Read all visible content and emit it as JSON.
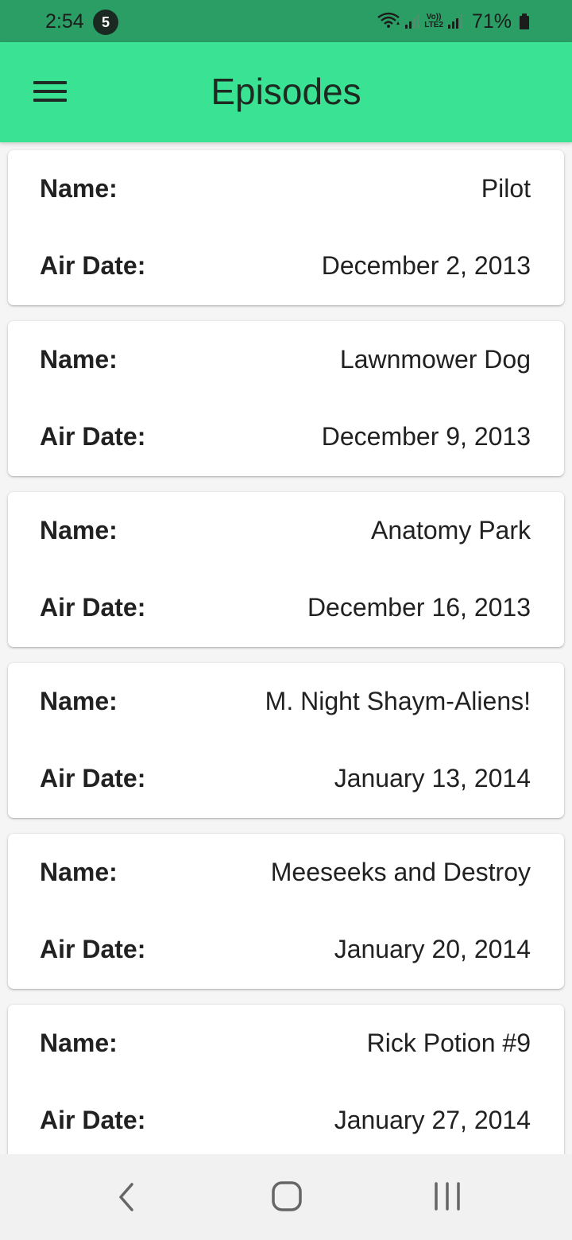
{
  "status_bar": {
    "time": "2:54",
    "notification_count": "5",
    "network_label_top": "Vo))",
    "network_label_bottom": "LTE2",
    "battery_percent": "71%"
  },
  "app_bar": {
    "title": "Episodes",
    "menu_icon": "hamburger-menu-icon",
    "background_color": "#3ae394"
  },
  "episodes": [
    {
      "name_label": "Name:",
      "name": "Pilot",
      "air_date_label": "Air Date:",
      "air_date": "December 2, 2013"
    },
    {
      "name_label": "Name:",
      "name": "Lawnmower Dog",
      "air_date_label": "Air Date:",
      "air_date": "December 9, 2013"
    },
    {
      "name_label": "Name:",
      "name": "Anatomy Park",
      "air_date_label": "Air Date:",
      "air_date": "December 16, 2013"
    },
    {
      "name_label": "Name:",
      "name": "M. Night Shaym-Aliens!",
      "air_date_label": "Air Date:",
      "air_date": "January 13, 2014"
    },
    {
      "name_label": "Name:",
      "name": "Meeseeks and Destroy",
      "air_date_label": "Air Date:",
      "air_date": "January 20, 2014"
    },
    {
      "name_label": "Name:",
      "name": "Rick Potion #9",
      "air_date_label": "Air Date:",
      "air_date": "January 27, 2014"
    }
  ],
  "nav_bar": {
    "back_icon": "back-chevron-icon",
    "home_icon": "home-icon",
    "recents_icon": "recent-apps-icon"
  }
}
